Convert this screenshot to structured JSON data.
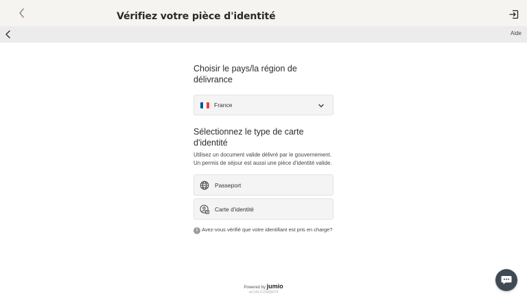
{
  "topbar": {
    "title": "Vérifiez votre pièce d'identité"
  },
  "subbar": {
    "help_label": "Aide"
  },
  "country": {
    "heading": "Choisir le pays/la région de délivrance",
    "selected": "France",
    "flag_colors": [
      "#0055a4",
      "#ffffff",
      "#ef4135"
    ]
  },
  "id_type": {
    "heading": "Sélectionnez le type de carte d'identité",
    "description": "Utilisez un document valide délivré par le gouvernement. Un permis de séjour est aussi une pièce d'identité valide.",
    "options": [
      {
        "label": "Passeport",
        "icon": "globe-icon"
      },
      {
        "label": "Carte d'identité",
        "icon": "id-card-icon"
      }
    ]
  },
  "info": {
    "icon": "info-icon",
    "text": "Avez-vous vérifié que votre identifiant est pris en charge?"
  },
  "footer": {
    "powered_by": "Powered by",
    "brand": "jumio",
    "version": "v4.143.0-23435074"
  },
  "chat": {
    "icon": "chat-bubble-icon"
  }
}
